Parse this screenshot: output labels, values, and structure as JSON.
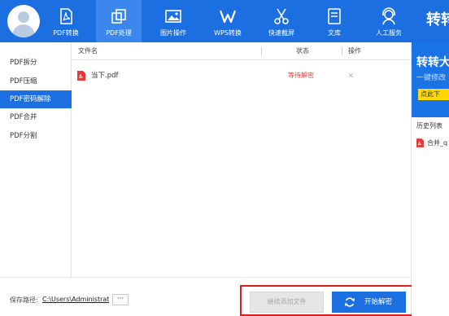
{
  "nav": {
    "items": [
      {
        "label": "PDF转换",
        "icon": "pdf-icon"
      },
      {
        "label": "PDF处理",
        "icon": "pages-icon"
      },
      {
        "label": "图片操作",
        "icon": "image-icon"
      },
      {
        "label": "WPS转换",
        "icon": "wps-icon"
      },
      {
        "label": "快速截屏",
        "icon": "scissors-icon"
      },
      {
        "label": "文库",
        "icon": "library-icon"
      },
      {
        "label": "人工服务",
        "icon": "support-icon"
      }
    ],
    "active_index": 1,
    "brand": "转转"
  },
  "sidebar": {
    "items": [
      {
        "label": "PDF拆分"
      },
      {
        "label": "PDF压缩"
      },
      {
        "label": "PDF密码解除"
      },
      {
        "label": "PDF合并"
      },
      {
        "label": "PDF分割"
      }
    ],
    "active_index": 2
  },
  "table": {
    "headers": {
      "filename": "文件名",
      "status": "状态",
      "action": "操作"
    },
    "rows": [
      {
        "filename": "当下.pdf",
        "status": "等待解密",
        "action": "×"
      }
    ]
  },
  "bottom": {
    "save_label": "保存路径:",
    "save_path": "C:\\Users\\Administrat",
    "more_label": "···",
    "add_button": "继续添加文件",
    "start_button": "开始解密"
  },
  "right_panel": {
    "ad_title": "转转大",
    "ad_subtitle": "一键修改",
    "ad_button": "点此下",
    "history_title": "历史列表",
    "history_items": [
      {
        "name": "合并_q"
      }
    ]
  },
  "colors": {
    "accent": "#1c6fe0",
    "status_waiting": "#e34242",
    "highlight_border": "#e21b1b"
  }
}
